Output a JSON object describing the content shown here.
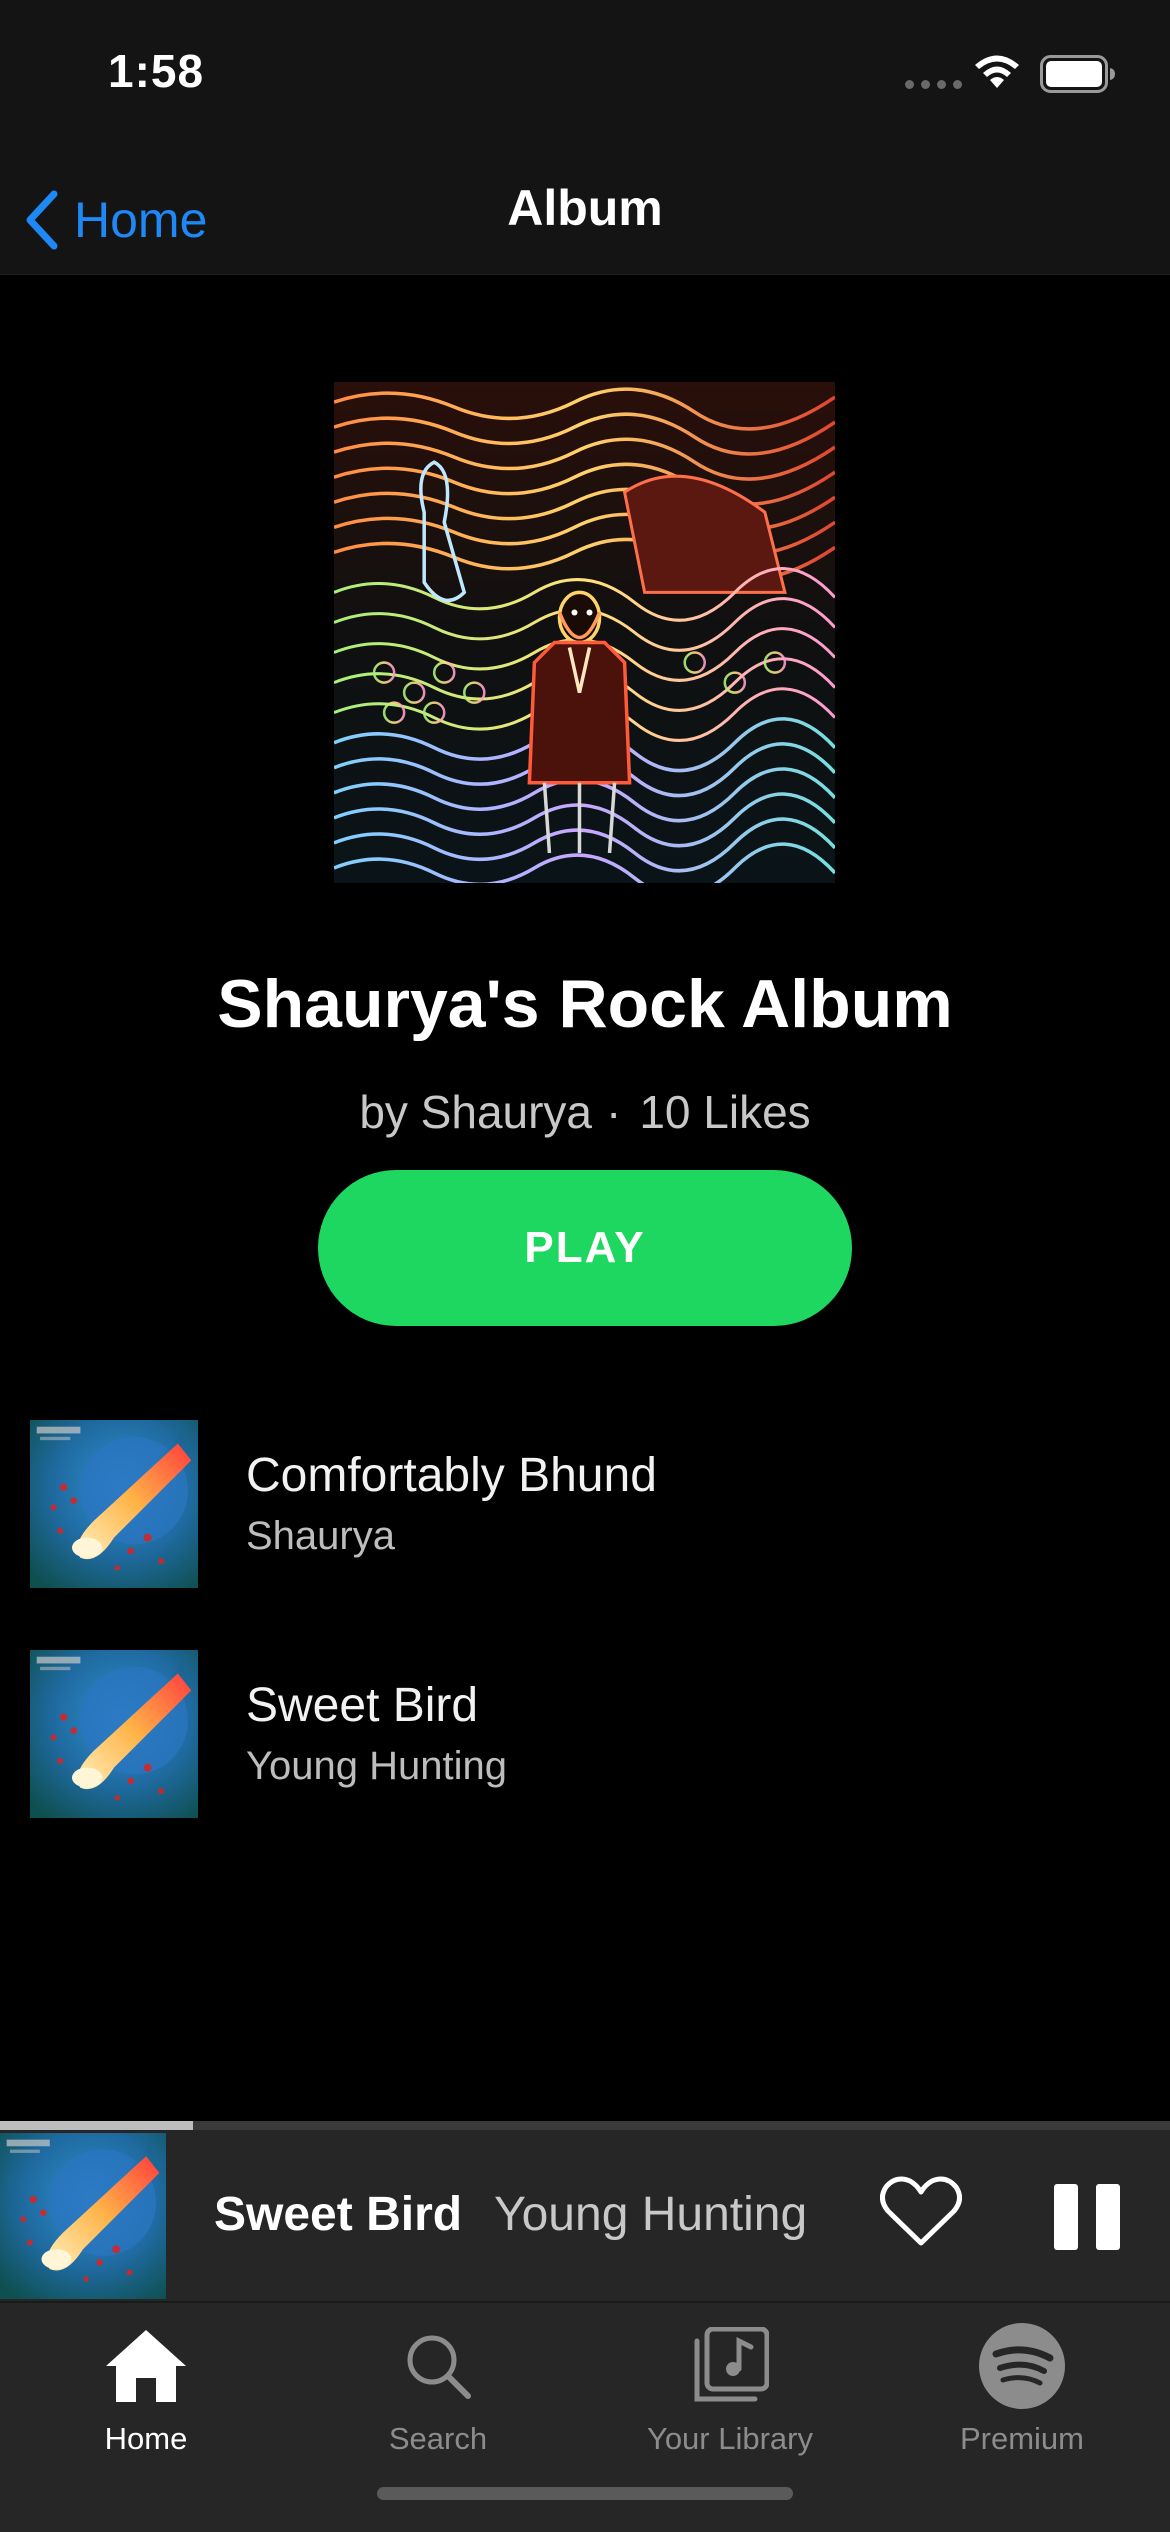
{
  "status_bar": {
    "time": "1:58"
  },
  "nav": {
    "back_label": "Home",
    "title": "Album"
  },
  "album": {
    "title": "Shaurya's Rock Album",
    "artist": "by Shaurya",
    "separator": "·",
    "likes": "10 Likes",
    "play_label": "PLAY"
  },
  "tracks": [
    {
      "title": "Comfortably Bhund",
      "artist": "Shaurya"
    },
    {
      "title": "Sweet Bird",
      "artist": "Young Hunting"
    }
  ],
  "now_playing": {
    "title": "Sweet Bird",
    "artist": "Young Hunting",
    "progress": 0.165
  },
  "tab_bar": {
    "tabs": [
      {
        "label": "Home",
        "icon": "home-icon",
        "active": true
      },
      {
        "label": "Search",
        "icon": "search-icon",
        "active": false
      },
      {
        "label": "Your Library",
        "icon": "library-icon",
        "active": false
      },
      {
        "label": "Premium",
        "icon": "spotify-icon",
        "active": false
      }
    ]
  },
  "colors": {
    "accent": "#1ed760",
    "link": "#1e88f5",
    "background": "#000000",
    "bar_background": "#262626"
  }
}
